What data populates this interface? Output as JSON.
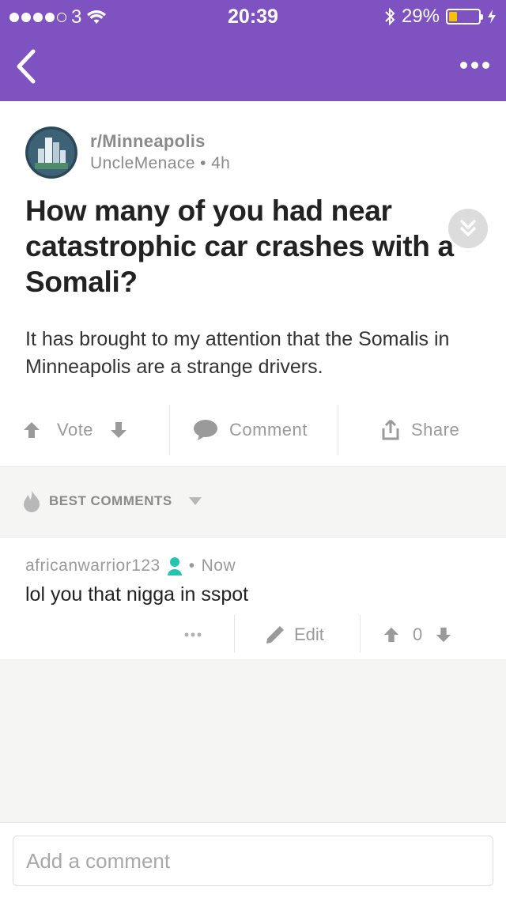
{
  "status_bar": {
    "carrier": "3",
    "time": "20:39",
    "battery_pct": "29%",
    "battery_level": 0.29,
    "battery_color": "#f4c20d"
  },
  "nav": {
    "background": "#7e53c1",
    "back_icon": "chevron-left-icon",
    "more_icon": "more-horizontal-icon"
  },
  "post": {
    "subreddit": "r/Minneapolis",
    "author": "UncleMenace",
    "separator": "•",
    "age": "4h",
    "title": "How many of you had near catastrophic car crashes with a Somali?",
    "body": "It has brought to my attention that the Somalis in Minneapolis are a strange drivers.",
    "actions": {
      "vote": "Vote",
      "comment": "Comment",
      "share": "Share"
    }
  },
  "comments": {
    "sort_label": "BEST COMMENTS",
    "items": [
      {
        "author": "africanwarrior123",
        "separator": "•",
        "time": "Now",
        "body": "lol you that nigga in sspot",
        "edit": "Edit",
        "score": "0"
      }
    ]
  },
  "composer": {
    "placeholder": "Add a comment"
  }
}
